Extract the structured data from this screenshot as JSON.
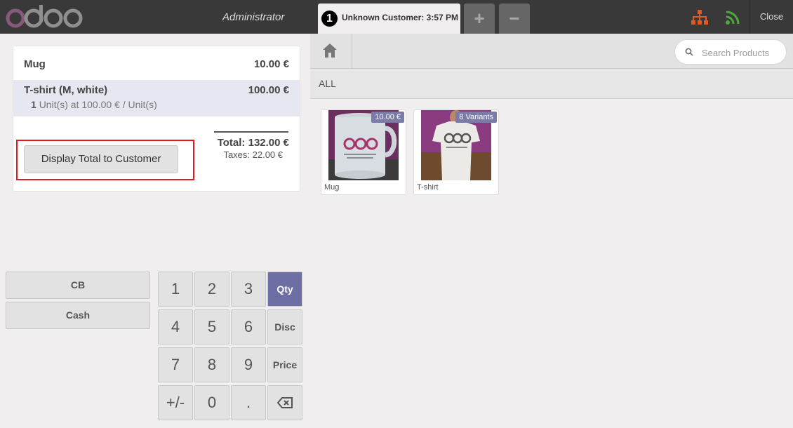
{
  "header": {
    "logo_text": "odoo",
    "user": "Administrator",
    "order_tab": {
      "number": "1",
      "label": "Unknown Customer: 3:57 PM"
    },
    "add_order": "+",
    "remove_order": "−",
    "close_label": "Close",
    "colors": {
      "network_icon": "#e05a20",
      "wifi_icon": "#4fa83d"
    }
  },
  "order": {
    "lines": [
      {
        "name": "Mug",
        "price": "10.00 €",
        "qty": "",
        "unit_info": ""
      },
      {
        "name": "T-shirt (M, white)",
        "price": "100.00 €",
        "qty": "1",
        "unit_info": "Unit(s) at 100.00 € / Unit(s)"
      }
    ],
    "total": "Total: 132.00 €",
    "taxes": "Taxes: 22.00 €",
    "display_total_button": "Display Total to Customer"
  },
  "payment_methods": [
    "CB",
    "Cash"
  ],
  "numpad": {
    "keys": [
      "1",
      "2",
      "3",
      "4",
      "5",
      "6",
      "7",
      "8",
      "9",
      "+/-",
      "0",
      "."
    ],
    "modes": [
      "Qty",
      "Disc",
      "Price"
    ],
    "active_mode": "Qty",
    "backspace_icon": "backspace-icon"
  },
  "products_area": {
    "search_placeholder": "Search Products",
    "category": "ALL",
    "products": [
      {
        "name": "Mug",
        "tag": "10.00 €"
      },
      {
        "name": "T-shirt",
        "tag": "8 Variants"
      }
    ]
  }
}
